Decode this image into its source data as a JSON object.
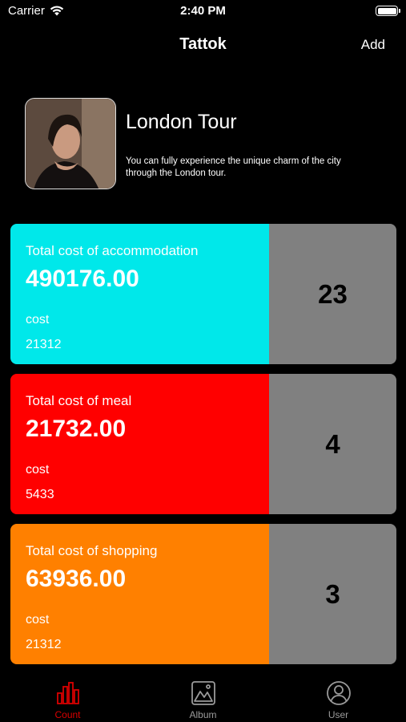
{
  "status_bar": {
    "carrier": "Carrier",
    "time": "2:40 PM"
  },
  "nav": {
    "title": "Tattok",
    "add_label": "Add"
  },
  "profile": {
    "title": "London Tour",
    "description": "You can fully experience the unique charm of the city through the London tour."
  },
  "cards": [
    {
      "label": "Total cost of accommodation",
      "amount": "490176.00",
      "cost_label": "cost",
      "cost_value": "21312",
      "count": "23",
      "color": "#00e8ea"
    },
    {
      "label": "Total cost of meal",
      "amount": "21732.00",
      "cost_label": "cost",
      "cost_value": "5433",
      "count": "4",
      "color": "#ff0000"
    },
    {
      "label": "Total cost of shopping",
      "amount": "63936.00",
      "cost_label": "cost",
      "cost_value": "21312",
      "count": "3",
      "color": "#ff8000"
    }
  ],
  "tabs": [
    {
      "label": "Count",
      "icon": "bar-chart-icon",
      "active": true
    },
    {
      "label": "Album",
      "icon": "image-icon",
      "active": false
    },
    {
      "label": "User",
      "icon": "user-icon",
      "active": false
    }
  ],
  "colors": {
    "active_tab": "#d90000",
    "count_panel": "#808080"
  }
}
